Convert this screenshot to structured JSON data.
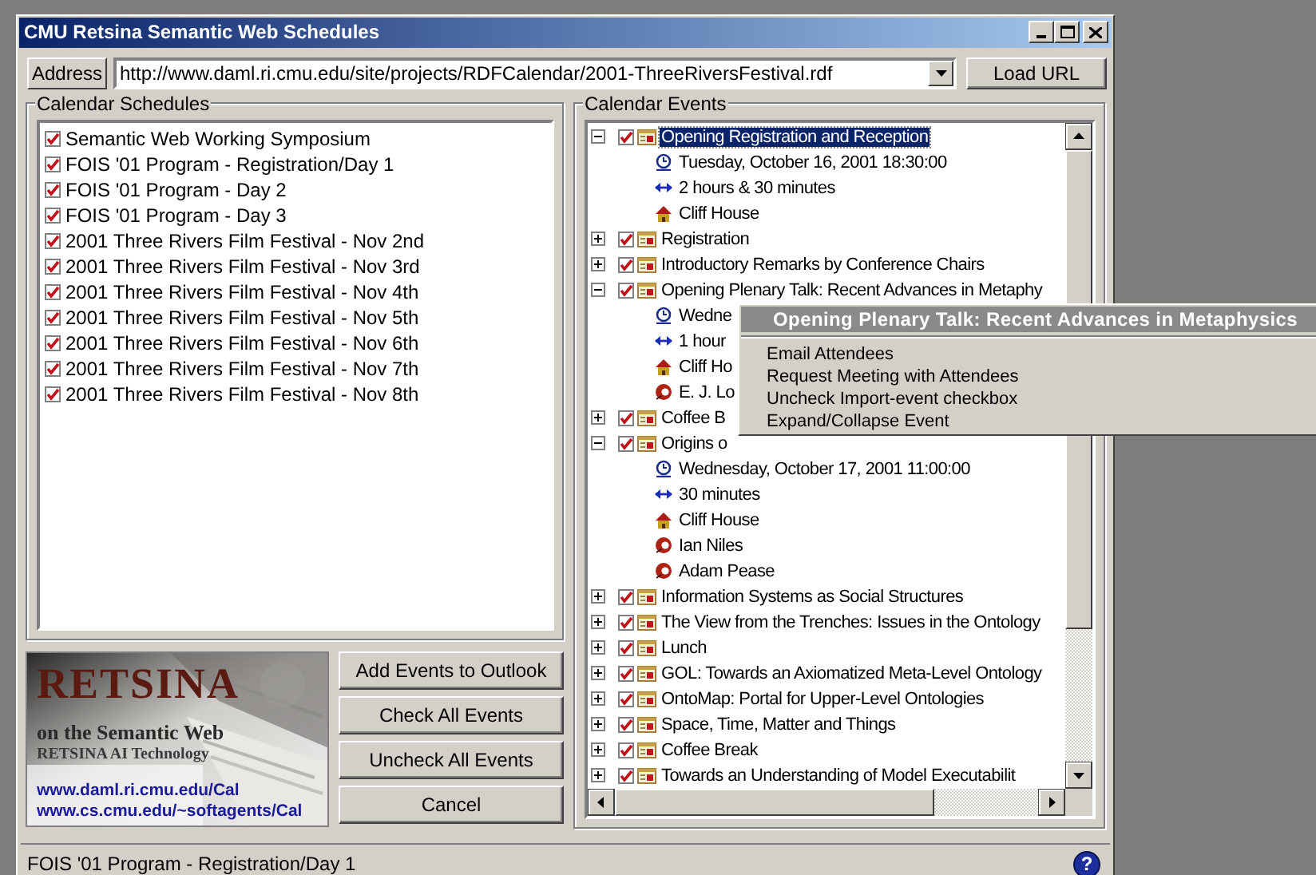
{
  "window": {
    "title": "CMU Retsina Semantic Web Schedules"
  },
  "address": {
    "label": "Address",
    "value": "http://www.daml.ri.cmu.edu/site/projects/RDFCalendar/2001-ThreeRiversFestival.rdf",
    "button": "Load URL"
  },
  "schedules": {
    "title": "Calendar Schedules",
    "items": [
      {
        "label": "Semantic Web Working Symposium",
        "checked": true
      },
      {
        "label": "FOIS '01 Program - Registration/Day 1",
        "checked": true
      },
      {
        "label": "FOIS '01 Program - Day 2",
        "checked": true
      },
      {
        "label": "FOIS '01 Program - Day 3",
        "checked": true
      },
      {
        "label": "2001 Three Rivers Film Festival - Nov 2nd",
        "checked": true
      },
      {
        "label": "2001 Three Rivers Film Festival - Nov 3rd",
        "checked": true
      },
      {
        "label": "2001 Three Rivers Film Festival - Nov 4th",
        "checked": true
      },
      {
        "label": "2001 Three Rivers Film Festival - Nov 5th",
        "checked": true
      },
      {
        "label": "2001 Three Rivers Film Festival - Nov 6th",
        "checked": true
      },
      {
        "label": "2001 Three Rivers Film Festival - Nov 7th",
        "checked": true
      },
      {
        "label": "2001 Three Rivers Film Festival - Nov 8th",
        "checked": true
      }
    ]
  },
  "banner": {
    "title": "RETSINA",
    "subtitle": "on the Semantic Web",
    "tagline": "RETSINA AI Technology",
    "links": [
      "www.daml.ri.cmu.edu/Cal",
      "www.cs.cmu.edu/~softagents/Cal"
    ]
  },
  "actions": [
    "Add Events to Outlook",
    "Check All Events",
    "Uncheck All Events",
    "Cancel"
  ],
  "events": {
    "title": "Calendar Events",
    "items": [
      {
        "label": "Opening Registration and Reception",
        "checked": true,
        "expanded": true,
        "selected": true,
        "children": [
          {
            "kind": "time",
            "label": "Tuesday, October 16, 2001 18:30:00"
          },
          {
            "kind": "duration",
            "label": "2 hours & 30 minutes"
          },
          {
            "kind": "place",
            "label": "Cliff House"
          }
        ]
      },
      {
        "label": "Registration",
        "checked": true,
        "expanded": false,
        "selected": false
      },
      {
        "label": "Introductory Remarks by Conference Chairs",
        "checked": true,
        "expanded": false,
        "selected": false
      },
      {
        "label": "Opening Plenary Talk: Recent Advances in Metaphy",
        "checked": true,
        "expanded": true,
        "selected": false,
        "children": [
          {
            "kind": "time",
            "label": "Wedne"
          },
          {
            "kind": "duration",
            "label": "1 hour"
          },
          {
            "kind": "place",
            "label": "Cliff Ho"
          },
          {
            "kind": "person",
            "label": "E. J. Lo"
          }
        ]
      },
      {
        "label": "Coffee B",
        "checked": true,
        "expanded": false,
        "selected": false
      },
      {
        "label": "Origins o",
        "checked": true,
        "expanded": true,
        "selected": false,
        "children": [
          {
            "kind": "time",
            "label": "Wednesday, October 17, 2001 11:00:00"
          },
          {
            "kind": "duration",
            "label": "30 minutes"
          },
          {
            "kind": "place",
            "label": "Cliff House"
          },
          {
            "kind": "person",
            "label": "Ian Niles"
          },
          {
            "kind": "person",
            "label": "Adam Pease"
          }
        ]
      },
      {
        "label": "Information Systems as Social Structures",
        "checked": true,
        "expanded": false,
        "selected": false
      },
      {
        "label": "The View from the Trenches: Issues in the Ontology",
        "checked": true,
        "expanded": false,
        "selected": false
      },
      {
        "label": "Lunch",
        "checked": true,
        "expanded": false,
        "selected": false
      },
      {
        "label": "GOL: Towards an Axiomatized Meta-Level Ontology",
        "checked": true,
        "expanded": false,
        "selected": false
      },
      {
        "label": "OntoMap: Portal for Upper-Level Ontologies",
        "checked": true,
        "expanded": false,
        "selected": false
      },
      {
        "label": "Space, Time, Matter and Things",
        "checked": true,
        "expanded": false,
        "selected": false
      },
      {
        "label": "Coffee Break",
        "checked": true,
        "expanded": false,
        "selected": false
      },
      {
        "label": "Towards an Understanding of Model Executabilit",
        "checked": true,
        "expanded": false,
        "selected": false
      }
    ]
  },
  "context_menu": {
    "title": "Opening Plenary Talk: Recent Advances in Metaphysics",
    "items": [
      "Email Attendees",
      "Request Meeting with Attendees",
      "Uncheck Import-event checkbox",
      "Expand/Collapse Event"
    ]
  },
  "status_bar": {
    "text": "FOIS '01 Program - Registration/Day 1",
    "help": "?"
  }
}
